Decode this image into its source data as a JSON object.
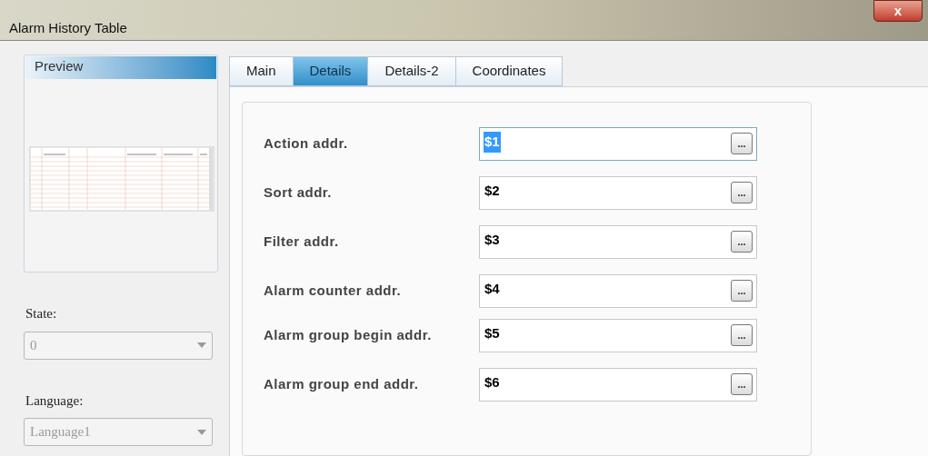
{
  "window": {
    "title": "Alarm History Table",
    "close": "x"
  },
  "preview": {
    "title": "Preview"
  },
  "state": {
    "label": "State:",
    "value": "0",
    "disabled": true
  },
  "language": {
    "label": "Language:",
    "value": "Language1",
    "disabled": true
  },
  "tabs": [
    {
      "label": "Main",
      "selected": false
    },
    {
      "label": "Details",
      "selected": true
    },
    {
      "label": "Details-2",
      "selected": false
    },
    {
      "label": "Coordinates",
      "selected": false
    }
  ],
  "fields": [
    {
      "label": "Action addr.",
      "value": "$1",
      "selected": true,
      "button": "..."
    },
    {
      "label": "Sort addr.",
      "value": "$2",
      "selected": false,
      "button": "..."
    },
    {
      "label": "Filter addr.",
      "value": "$3",
      "selected": false,
      "button": "..."
    },
    {
      "label": "Alarm counter addr.",
      "value": "$4",
      "selected": false,
      "button": "..."
    },
    {
      "label": "Alarm group begin addr.",
      "value": "$5",
      "selected": false,
      "button": "..."
    },
    {
      "label": "Alarm group end addr.",
      "value": "$6",
      "selected": false,
      "button": "..."
    }
  ]
}
